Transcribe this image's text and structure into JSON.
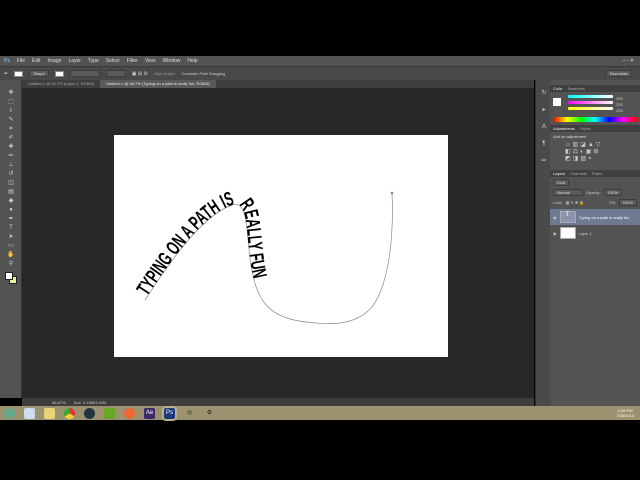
{
  "app": {
    "ps_logo": "Ps"
  },
  "menu": [
    "File",
    "Edit",
    "Image",
    "Layer",
    "Type",
    "Select",
    "Filter",
    "View",
    "Window",
    "Help"
  ],
  "options": {
    "mode": "Shape",
    "align_edges": "Align Edges",
    "constrain": "Constrain Path Dragging"
  },
  "workspace": "Essentials",
  "tabs": [
    {
      "label": "Untitled-1 @ 66.7% (Layer 1, RGB/8)",
      "active": false
    },
    {
      "label": "Untitled-1 @ 66.7% (Typing on a path is really fun, RGB/8)",
      "active": true
    }
  ],
  "canvas": {
    "path_text": "TYPING ON A PATH IS REALLY FUN",
    "background": "#ffffff"
  },
  "status": {
    "zoom": "66.67%",
    "doc": "Doc: 1.15M/1.01M"
  },
  "panels": {
    "color": {
      "tabs": [
        "Color",
        "Swatches"
      ],
      "channels": [
        {
          "label": "R",
          "value": "255"
        },
        {
          "label": "G",
          "value": "255"
        },
        {
          "label": "B",
          "value": "255"
        }
      ]
    },
    "adjustments": {
      "tabs": [
        "Adjustments",
        "Styles"
      ],
      "title": "Add an adjustment"
    },
    "layers": {
      "tabs": [
        "Layers",
        "Channels",
        "Paths"
      ],
      "kind": "Kind",
      "blend": "Normal",
      "opacity_label": "Opacity:",
      "opacity": "100%",
      "lock_label": "Lock:",
      "fill_label": "Fill:",
      "fill": "100%",
      "items": [
        {
          "name": "Typing on a path is really fun",
          "type": "text",
          "selected": true
        },
        {
          "name": "Layer 1",
          "type": "pixel",
          "selected": false
        }
      ]
    }
  },
  "taskbar": {
    "time": "2:35 PM",
    "date": "7/25/2013",
    "apps": [
      "Recycle Bin",
      "Files",
      "Explorer",
      "Chrome",
      "Steam",
      "Camtasia",
      "Origin",
      "After Effects",
      "Photoshop",
      "Media",
      "Tools"
    ]
  }
}
